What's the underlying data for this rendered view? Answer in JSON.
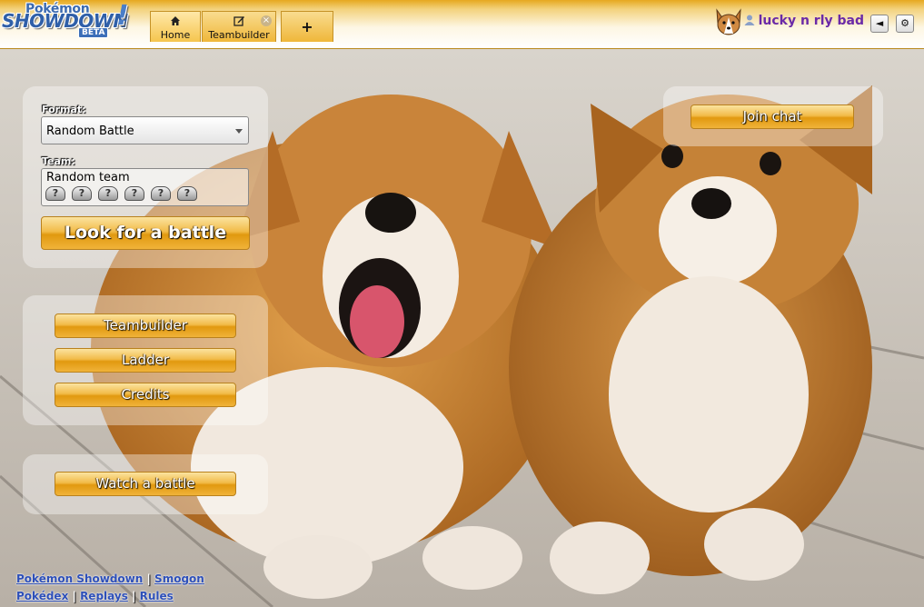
{
  "header": {
    "logo": {
      "pokemon": "Pokémon",
      "showdown": "SHOWDOWN",
      "beta": "BETA"
    },
    "tabs": [
      {
        "icon": "home-icon",
        "label": "Home",
        "active": true
      },
      {
        "icon": "edit-icon",
        "label": "Teambuilder",
        "closable": true
      },
      {
        "icon": "plus-icon",
        "label": "+"
      }
    ],
    "username": "lucky n rly bad",
    "buttons": {
      "mute": "◄",
      "options": "⚙"
    }
  },
  "battle_panel": {
    "format_label": "Format:",
    "format_value": "Random Battle",
    "team_label": "Team:",
    "team_value": "Random team",
    "slots": [
      "?",
      "?",
      "?",
      "?",
      "?",
      "?"
    ],
    "search_button": "Look for a battle"
  },
  "menu": {
    "teambuilder": "Teambuilder",
    "ladder": "Ladder",
    "credits": "Credits",
    "watch": "Watch a battle"
  },
  "chat": {
    "join": "Join chat"
  },
  "footer": {
    "link1": "Pokémon Showdown",
    "sep1": " | ",
    "link2": "Smogon",
    "link3": "Pokédex",
    "sep2": " | ",
    "link4": "Replays",
    "sep3": " | ",
    "link5": "Rules"
  },
  "colors": {
    "accent": "#f0b33a",
    "username": "#6a2aa8",
    "link": "#2d4fb8"
  }
}
